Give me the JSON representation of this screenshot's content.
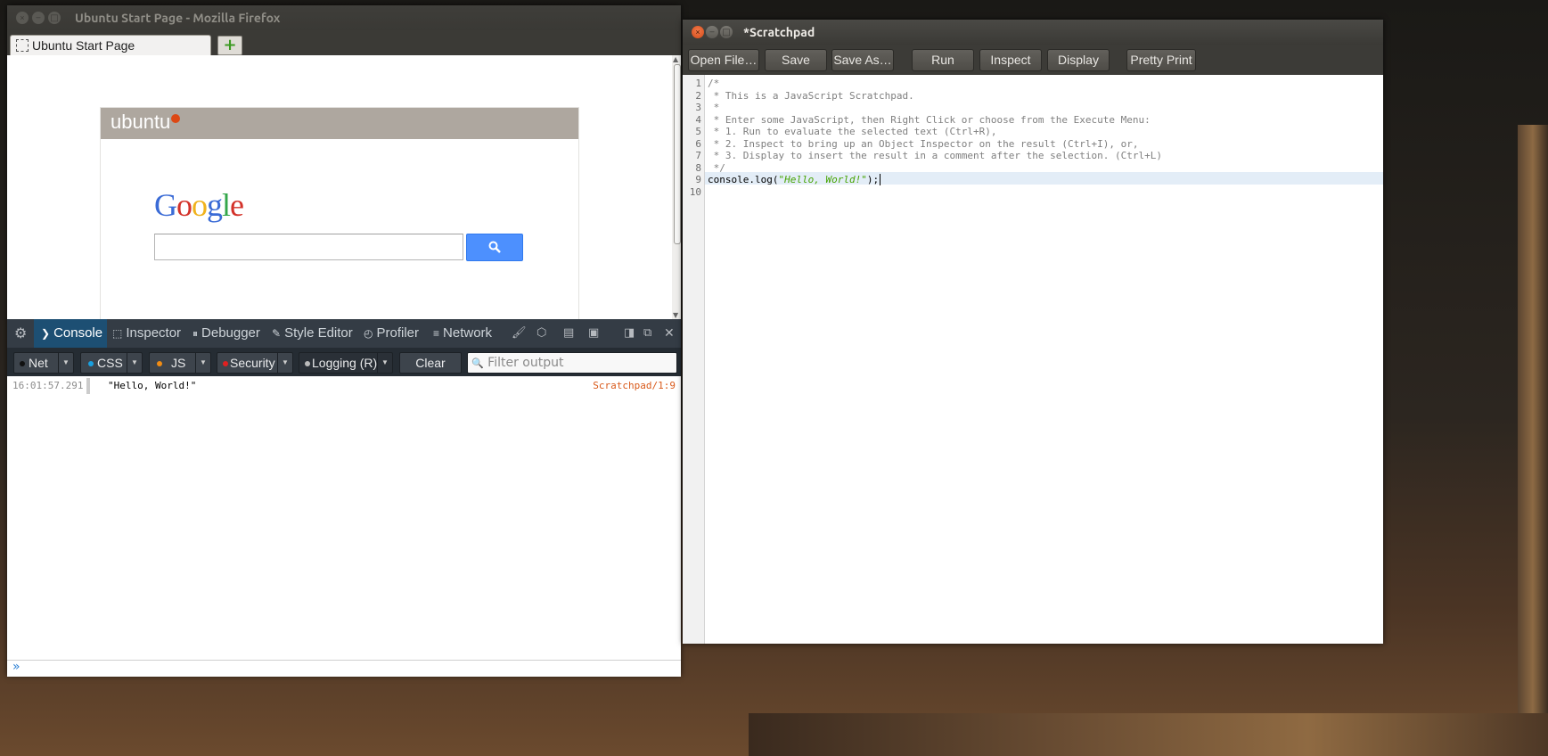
{
  "firefox": {
    "title": "Ubuntu Start Page - Mozilla Firefox",
    "tab_label": "Ubuntu Start Page",
    "new_tab_symbol": "+",
    "ubuntu_logo": "ubuntu",
    "google": {
      "letters": [
        "G",
        "o",
        "o",
        "g",
        "l",
        "e"
      ],
      "colors": [
        "#3a6bd6",
        "#d3322a",
        "#f0b21c",
        "#3a6bd6",
        "#33a64a",
        "#d3322a"
      ],
      "search_value": "",
      "search_icon": "search-icon"
    },
    "devtools": {
      "tabs": [
        {
          "label": "Console",
          "icon": "console-icon"
        },
        {
          "label": "Inspector",
          "icon": "inspector-icon"
        },
        {
          "label": "Debugger",
          "icon": "debugger-icon"
        },
        {
          "label": "Style Editor",
          "icon": "style-editor-icon"
        },
        {
          "label": "Profiler",
          "icon": "profiler-icon"
        },
        {
          "label": "Network",
          "icon": "network-icon"
        }
      ],
      "selected_tab": "Console",
      "filters": [
        {
          "label": "Net",
          "color": "#222222"
        },
        {
          "label": "CSS",
          "color": "#19a0e0"
        },
        {
          "label": "JS",
          "color": "#f08c14"
        },
        {
          "label": "Security",
          "color": "#e02020"
        },
        {
          "label": "Logging (R)",
          "color": "#bbbbbb"
        }
      ],
      "clear_label": "Clear",
      "filter_placeholder": "Filter output",
      "log": {
        "timestamp": "16:01:57.291",
        "message": "\"Hello, World!\"",
        "source": "Scratchpad/1:9"
      },
      "input_prompt": "»"
    }
  },
  "scratchpad": {
    "title": "*Scratchpad",
    "toolbar": {
      "open_label": "Open File…",
      "save_label": "Save",
      "save_as_label": "Save As…",
      "run_label": "Run",
      "inspect_label": "Inspect",
      "display_label": "Display",
      "pretty_label": "Pretty Print"
    },
    "lines": [
      "/*",
      " * This is a JavaScript Scratchpad.",
      " *",
      " * Enter some JavaScript, then Right Click or choose from the Execute Menu:",
      " * 1. Run to evaluate the selected text (Ctrl+R),",
      " * 2. Inspect to bring up an Object Inspector on the result (Ctrl+I), or,",
      " * 3. Display to insert the result in a comment after the selection. (Ctrl+L)",
      " */",
      "console.log(\"Hello, World!\");",
      ""
    ],
    "code_prefix": "console.log(",
    "code_string": "\"Hello, World!\"",
    "code_suffix": ");"
  }
}
